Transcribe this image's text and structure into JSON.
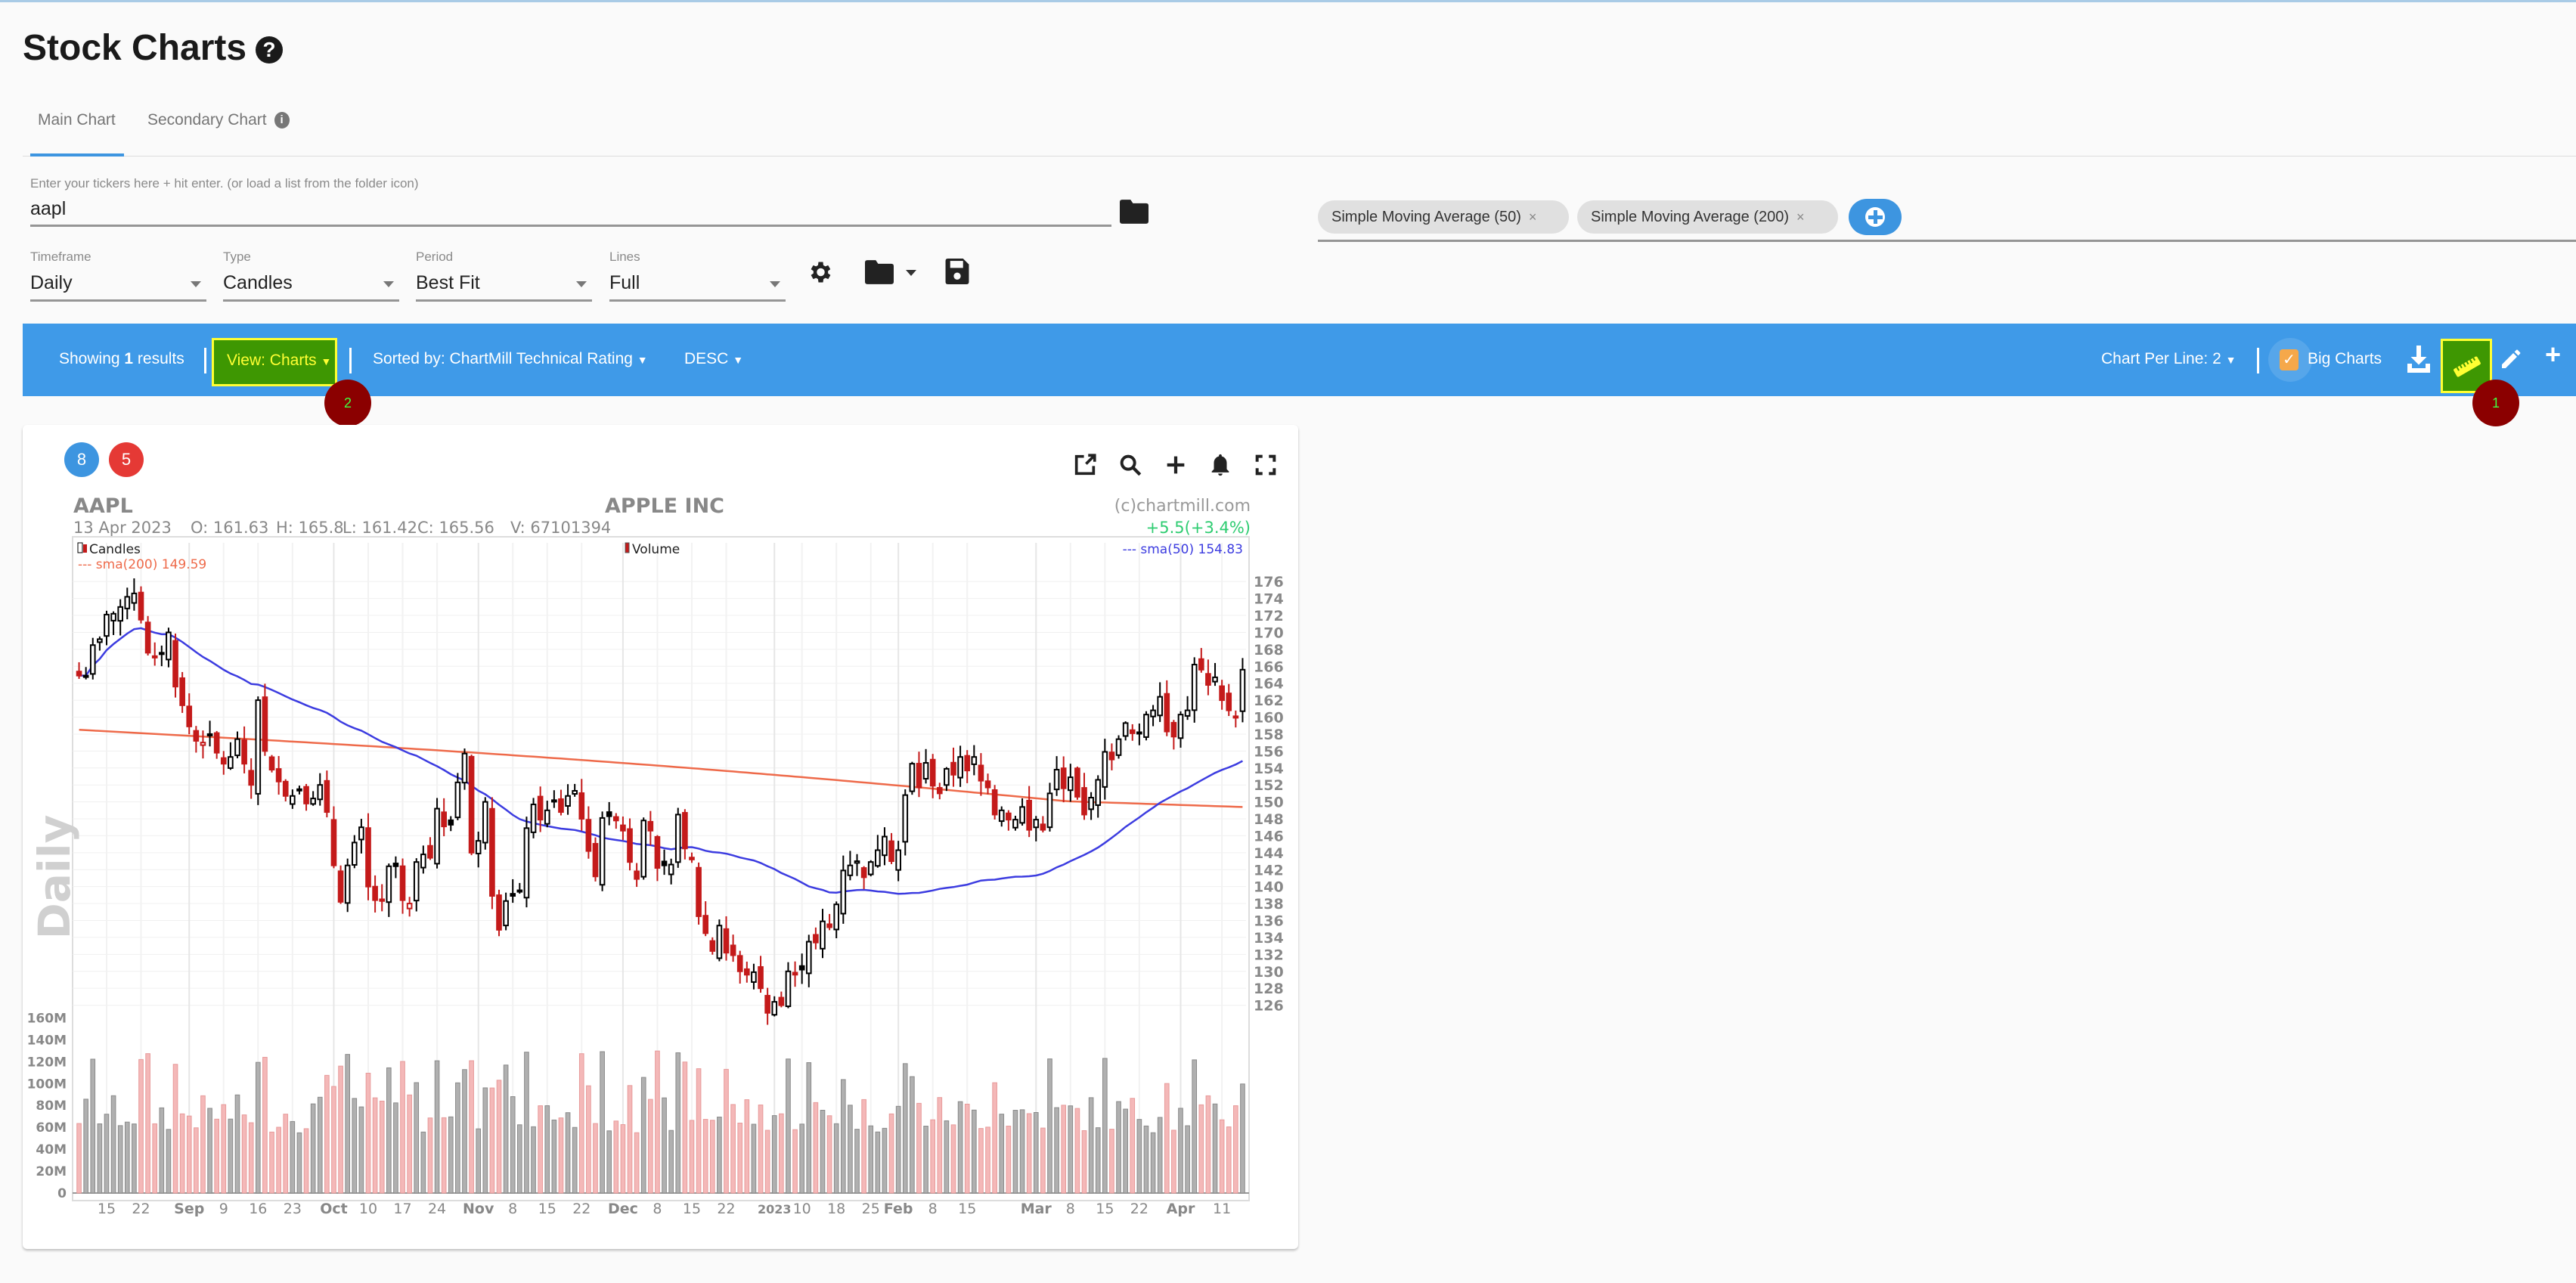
{
  "page": {
    "title": "Stock Charts",
    "help_icon": "question-circle-icon"
  },
  "tabs": [
    {
      "label": "Main Chart",
      "active": true
    },
    {
      "label": "Secondary Chart",
      "active": false,
      "icon": "info-icon"
    }
  ],
  "ticker_input": {
    "label": "Enter your tickers here + hit enter. (or load a list from the folder icon)",
    "value": "aapl",
    "folder_icon": "folder-icon"
  },
  "selects": [
    {
      "label": "Timeframe",
      "value": "Daily"
    },
    {
      "label": "Type",
      "value": "Candles"
    },
    {
      "label": "Period",
      "value": "Best Fit"
    },
    {
      "label": "Lines",
      "value": "Full"
    }
  ],
  "settings_icons": [
    "gear-icon",
    "folder-icon",
    "save-icon"
  ],
  "indicators": [
    {
      "label": "Simple Moving Average (50)",
      "remove": "×"
    },
    {
      "label": "Simple Moving Average (200)",
      "remove": "×"
    }
  ],
  "toolbar": {
    "showing_prefix": "Showing ",
    "showing_count": "1",
    "showing_suffix": " results",
    "view": "View: Charts",
    "sorted_by": "Sorted by: ChartMill Technical Rating",
    "order": "DESC",
    "chart_per_line": "Chart Per Line: 2",
    "big_charts_label": "Big Charts",
    "big_charts_checked": true,
    "colors": {
      "bar": "#3f9ae8",
      "highlight": "#3e9702",
      "highlight_border": "#ffff33",
      "checkbox": "#f5a84a"
    }
  },
  "markers": [
    {
      "label": "2"
    },
    {
      "label": "1"
    }
  ],
  "card": {
    "badges": [
      {
        "label": "8",
        "color": "#3d95e0"
      },
      {
        "label": "5",
        "color": "#e53935"
      }
    ],
    "icons": [
      "open-external-icon",
      "search-icon",
      "plus-icon",
      "bell-icon",
      "fullscreen-icon"
    ]
  },
  "chart_data": {
    "type": "candlestick",
    "symbol": "AAPL",
    "company": "APPLE INC",
    "copyright": "(c)chartmill.com",
    "watermark": "Daily",
    "quote": {
      "date": "13 Apr 2023",
      "open": "161.63",
      "high": "165.8",
      "low": "161.42",
      "close": "165.56",
      "volume": "67101394",
      "change": "+5.5(+3.4%)"
    },
    "legend": {
      "candles": "Candles",
      "volume": "Volume",
      "sma50": "--- sma(50) 154.83",
      "sma200": "--- sma(200) 149.59"
    },
    "colors": {
      "up": "#000000",
      "down": "#c41a1a",
      "sma50": "#3c3ce0",
      "sma200": "#ee6a4a",
      "vol_up": "#b0b0b0",
      "vol_down": "#f4b8b8",
      "change": "#2ecc71"
    },
    "price_axis": {
      "min": 124,
      "max": 177,
      "ticks": [
        176,
        174,
        172,
        170,
        168,
        166,
        164,
        162,
        160,
        158,
        156,
        154,
        152,
        150,
        148,
        146,
        144,
        142,
        140,
        138,
        136,
        134,
        132,
        130,
        128,
        126
      ]
    },
    "volume_axis": {
      "max": 170,
      "unit": "M",
      "ticks": [
        "160M",
        "140M",
        "120M",
        "100M",
        "80M",
        "60M",
        "40M",
        "20M",
        "0"
      ]
    },
    "x_labels": [
      {
        "i": 4,
        "t": "15",
        "bold": false
      },
      {
        "i": 9,
        "t": "22",
        "bold": false
      },
      {
        "i": 16,
        "t": "Sep",
        "bold": true
      },
      {
        "i": 21,
        "t": "9",
        "bold": false
      },
      {
        "i": 26,
        "t": "16",
        "bold": false
      },
      {
        "i": 31,
        "t": "23",
        "bold": false
      },
      {
        "i": 37,
        "t": "Oct",
        "bold": true
      },
      {
        "i": 42,
        "t": "10",
        "bold": false
      },
      {
        "i": 47,
        "t": "17",
        "bold": false
      },
      {
        "i": 52,
        "t": "24",
        "bold": false
      },
      {
        "i": 58,
        "t": "Nov",
        "bold": true
      },
      {
        "i": 63,
        "t": "8",
        "bold": false
      },
      {
        "i": 68,
        "t": "15",
        "bold": false
      },
      {
        "i": 73,
        "t": "22",
        "bold": false
      },
      {
        "i": 79,
        "t": "Dec",
        "bold": true
      },
      {
        "i": 84,
        "t": "8",
        "bold": false
      },
      {
        "i": 89,
        "t": "15",
        "bold": false
      },
      {
        "i": 94,
        "t": "22",
        "bold": false
      },
      {
        "i": 101,
        "t": "2023",
        "bold": true
      },
      {
        "i": 105,
        "t": "10",
        "bold": false
      },
      {
        "i": 110,
        "t": "18",
        "bold": false
      },
      {
        "i": 115,
        "t": "25",
        "bold": false
      },
      {
        "i": 119,
        "t": "Feb",
        "bold": true
      },
      {
        "i": 124,
        "t": "8",
        "bold": false
      },
      {
        "i": 129,
        "t": "15",
        "bold": false
      },
      {
        "i": 139,
        "t": "Mar",
        "bold": true
      },
      {
        "i": 144,
        "t": "8",
        "bold": false
      },
      {
        "i": 149,
        "t": "15",
        "bold": false
      },
      {
        "i": 154,
        "t": "22",
        "bold": false
      },
      {
        "i": 160,
        "t": "Apr",
        "bold": true
      },
      {
        "i": 166,
        "t": "11",
        "bold": false
      }
    ],
    "closes": [
      164.9,
      164.9,
      168.5,
      169.2,
      172.1,
      172.2,
      173.0,
      174.2,
      174.6,
      171.5,
      167.6,
      167.2,
      167.6,
      170.0,
      163.6,
      161.4,
      158.9,
      157.2,
      157.0,
      158.0,
      155.8,
      154.5,
      155.3,
      157.4,
      154.5,
      152.0,
      162.0,
      156.0,
      153.8,
      152.4,
      150.7,
      150.7,
      151.5,
      149.8,
      150.4,
      152.0,
      148.8,
      142.5,
      138.2,
      142.5,
      145.2,
      147.0,
      140.0,
      138.4,
      138.3,
      142.4,
      142.4,
      138.4,
      138.0,
      142.9,
      143.8,
      143.4,
      149.2,
      147.1,
      147.3,
      152.3,
      155.7,
      144.0,
      145.4,
      150.0,
      138.9,
      134.9,
      138.3,
      138.9,
      139.5,
      146.9,
      149.7,
      147.9,
      149.0,
      150.2,
      148.8,
      150.7,
      151.3,
      148.0,
      144.2,
      141.2,
      148.1,
      148.3,
      147.8,
      146.6,
      142.9,
      140.9,
      147.8,
      146.6,
      142.2,
      142.5,
      142.6,
      148.5,
      144.5,
      143.2,
      136.5,
      134.5,
      132.4,
      135.4,
      132.2,
      131.9,
      130.0,
      129.6,
      129.9,
      128.0,
      125.1,
      126.4,
      126.0,
      130.0,
      129.6,
      130.2,
      133.5,
      133.4,
      135.9,
      135.2,
      137.9,
      141.9,
      142.5,
      143.0,
      141.1,
      142.9,
      144.3,
      145.9,
      143.0,
      144.3,
      150.8,
      154.5,
      151.7,
      154.6,
      151.9,
      151.0,
      153.9,
      153.2,
      155.3,
      153.7,
      155.3,
      152.5,
      151.7,
      148.5,
      149.0,
      147.9,
      147.9,
      149.4,
      146.7,
      147.9,
      146.7,
      151.0,
      153.8,
      151.6,
      152.9,
      150.6,
      148.5,
      150.5,
      152.6,
      155.9,
      155.0,
      157.4,
      159.3,
      158.1,
      158.1,
      160.3,
      160.8,
      162.4,
      158.3,
      157.7,
      160.3,
      160.8,
      166.2,
      165.6,
      163.8,
      164.7,
      162.0,
      160.8,
      160.1,
      165.6
    ],
    "sma50_last": 154.83,
    "sma200_last": 149.59
  }
}
